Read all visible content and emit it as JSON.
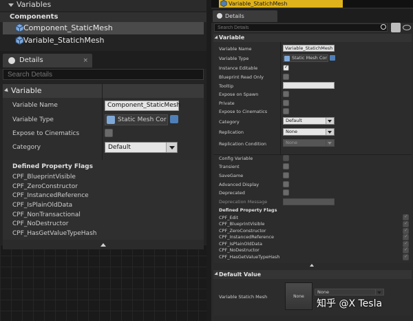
{
  "left": {
    "variables_header": "Variables",
    "components_header": "Components",
    "items": [
      {
        "label": "Component_StaticMesh"
      },
      {
        "label": "Variable_StatichMesh"
      }
    ],
    "details_tab": "Details",
    "search_placeholder": "Search Details",
    "section": "Variable",
    "props": {
      "name_label": "Variable Name",
      "name_value": "Component_StaticMesh",
      "type_label": "Variable Type",
      "type_value": "Static Mesh Cor",
      "expose_label": "Expose to Cinematics",
      "category_label": "Category",
      "category_value": "Default"
    },
    "flags_header": "Defined Property Flags",
    "flags": [
      "CPF_BlueprintVisible",
      "CPF_ZeroConstructor",
      "CPF_InstancedReference",
      "CPF_IsPlainOldData",
      "CPF_NonTransactional",
      "CPF_NoDestructor",
      "CPF_HasGetValueTypeHash"
    ]
  },
  "right": {
    "title": "Variable_StatichMesh",
    "details_tab": "Details",
    "search_placeholder": "Search Details",
    "section": "Variable",
    "props": {
      "name_label": "Variable Name",
      "name_value": "Variable_StatichMesh",
      "type_label": "Variable Type",
      "type_value": "Static Mesh Cor",
      "instance_label": "Instance Editable",
      "readonly_label": "Blueprint Read Only",
      "tooltip_label": "Tooltip",
      "spawn_label": "Expose on Spawn",
      "private_label": "Private",
      "cinematics_label": "Expose to Cinematics",
      "category_label": "Category",
      "category_value": "Default",
      "replication_label": "Replication",
      "replication_value": "None",
      "repcond_label": "Replication Condition",
      "repcond_value": "None",
      "config_label": "Config Variable",
      "transient_label": "Transient",
      "savegame_label": "SaveGame",
      "advanced_label": "Advanced Display",
      "deprecated_label": "Deprecated",
      "depmsg_label": "Deprecation Message"
    },
    "flags_header": "Defined Property Flags",
    "flags": [
      "CPF_Edit",
      "CPF_BlueprintVisible",
      "CPF_ZeroConstructor",
      "CPF_InstancedReference",
      "CPF_IsPlainOldData",
      "CPF_NoDestructor",
      "CPF_HasGetValueTypeHash"
    ],
    "default_section": "Default Value",
    "default_label": "Variable Statich Mesh",
    "default_thumb": "None",
    "default_value": "None"
  },
  "watermark": "知乎 @X Tesla",
  "colors": {
    "title_bar": "#e0b31c",
    "selection": "#4a4a4a",
    "panel_bg": "#2c2c2c"
  }
}
